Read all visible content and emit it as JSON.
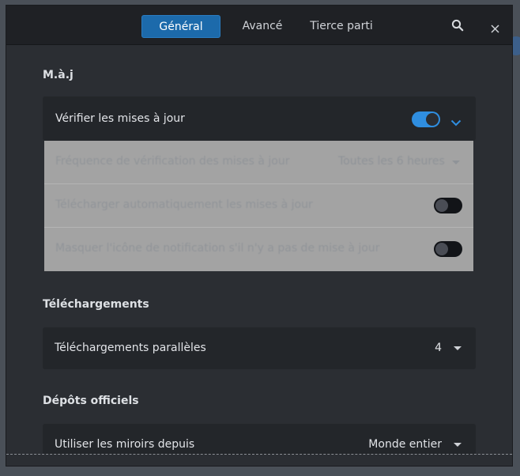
{
  "tabs": [
    {
      "label": "Général",
      "active": true
    },
    {
      "label": "Avancé",
      "active": false
    },
    {
      "label": "Tierce parti",
      "active": false
    }
  ],
  "header_icons": [
    "search-icon",
    "close-icon"
  ],
  "sections": {
    "updates": {
      "title": "M.à.j",
      "check_updates": {
        "label": "Vérifier les mises à jour",
        "enabled": true
      },
      "frequency": {
        "label": "Fréquence de vérification des mises à jour",
        "value": "Toutes les 6 heures"
      },
      "auto_download": {
        "label": "Télécharger automatiquement les mises à jour",
        "enabled": false
      },
      "hide_tray": {
        "label": "Masquer l'icône de notification s'il n'y a pas de mise à jour",
        "enabled": false
      }
    },
    "downloads": {
      "title": "Téléchargements",
      "parallel": {
        "label": "Téléchargements parallèles",
        "value": "4"
      }
    },
    "repos": {
      "title": "Dépôts officiels",
      "mirrors": {
        "label": "Utiliser les miroirs depuis",
        "value": "Monde entier"
      }
    }
  },
  "colors": {
    "accent": "#2f8ee0",
    "active_tab": "#1c6aab",
    "background": "#2b2e33",
    "card": "#23262a"
  }
}
